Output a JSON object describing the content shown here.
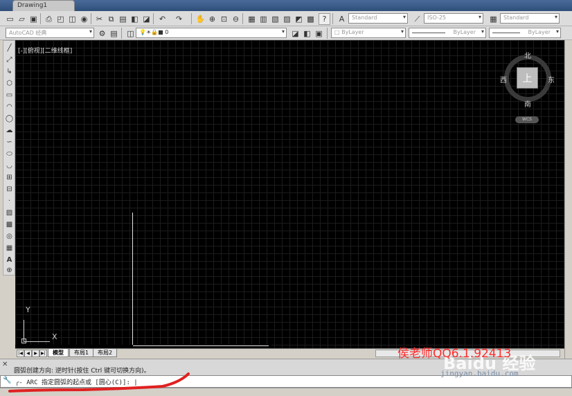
{
  "window": {
    "doc_tab": "Drawing1"
  },
  "toolbar1": {
    "text_style": "Standard",
    "dim_style": "ISO-25",
    "table_style": "Standard"
  },
  "toolbar2": {
    "workspace": "AutoCAD 经典",
    "layer": "0",
    "color": "ByLayer",
    "linetype": "ByLayer",
    "lineweight": "ByLayer"
  },
  "viewport": {
    "label": "[-][俯视][二维线框]",
    "viewcube": {
      "face": "上",
      "north": "北",
      "south": "南",
      "east": "东",
      "west": "西",
      "wcs": "WCS"
    },
    "ucs": {
      "x": "X",
      "y": "Y"
    }
  },
  "layout_tabs": [
    "模型",
    "布局1",
    "布局2"
  ],
  "command": {
    "history": "圆弧创建方向: 逆时针(按住 Ctrl 键可切换方向)。",
    "prompt": "ARC 指定圆弧的起点或 [圆心(C)]:"
  },
  "watermark": {
    "text": "侯老师QQ6.1.92413",
    "site": "jingyan.baidu.com",
    "brand": "Baidu 经验"
  },
  "colors": {
    "canvas": "#000000",
    "grid": "#1c1c1c",
    "watermark": "#ff2b2b"
  }
}
